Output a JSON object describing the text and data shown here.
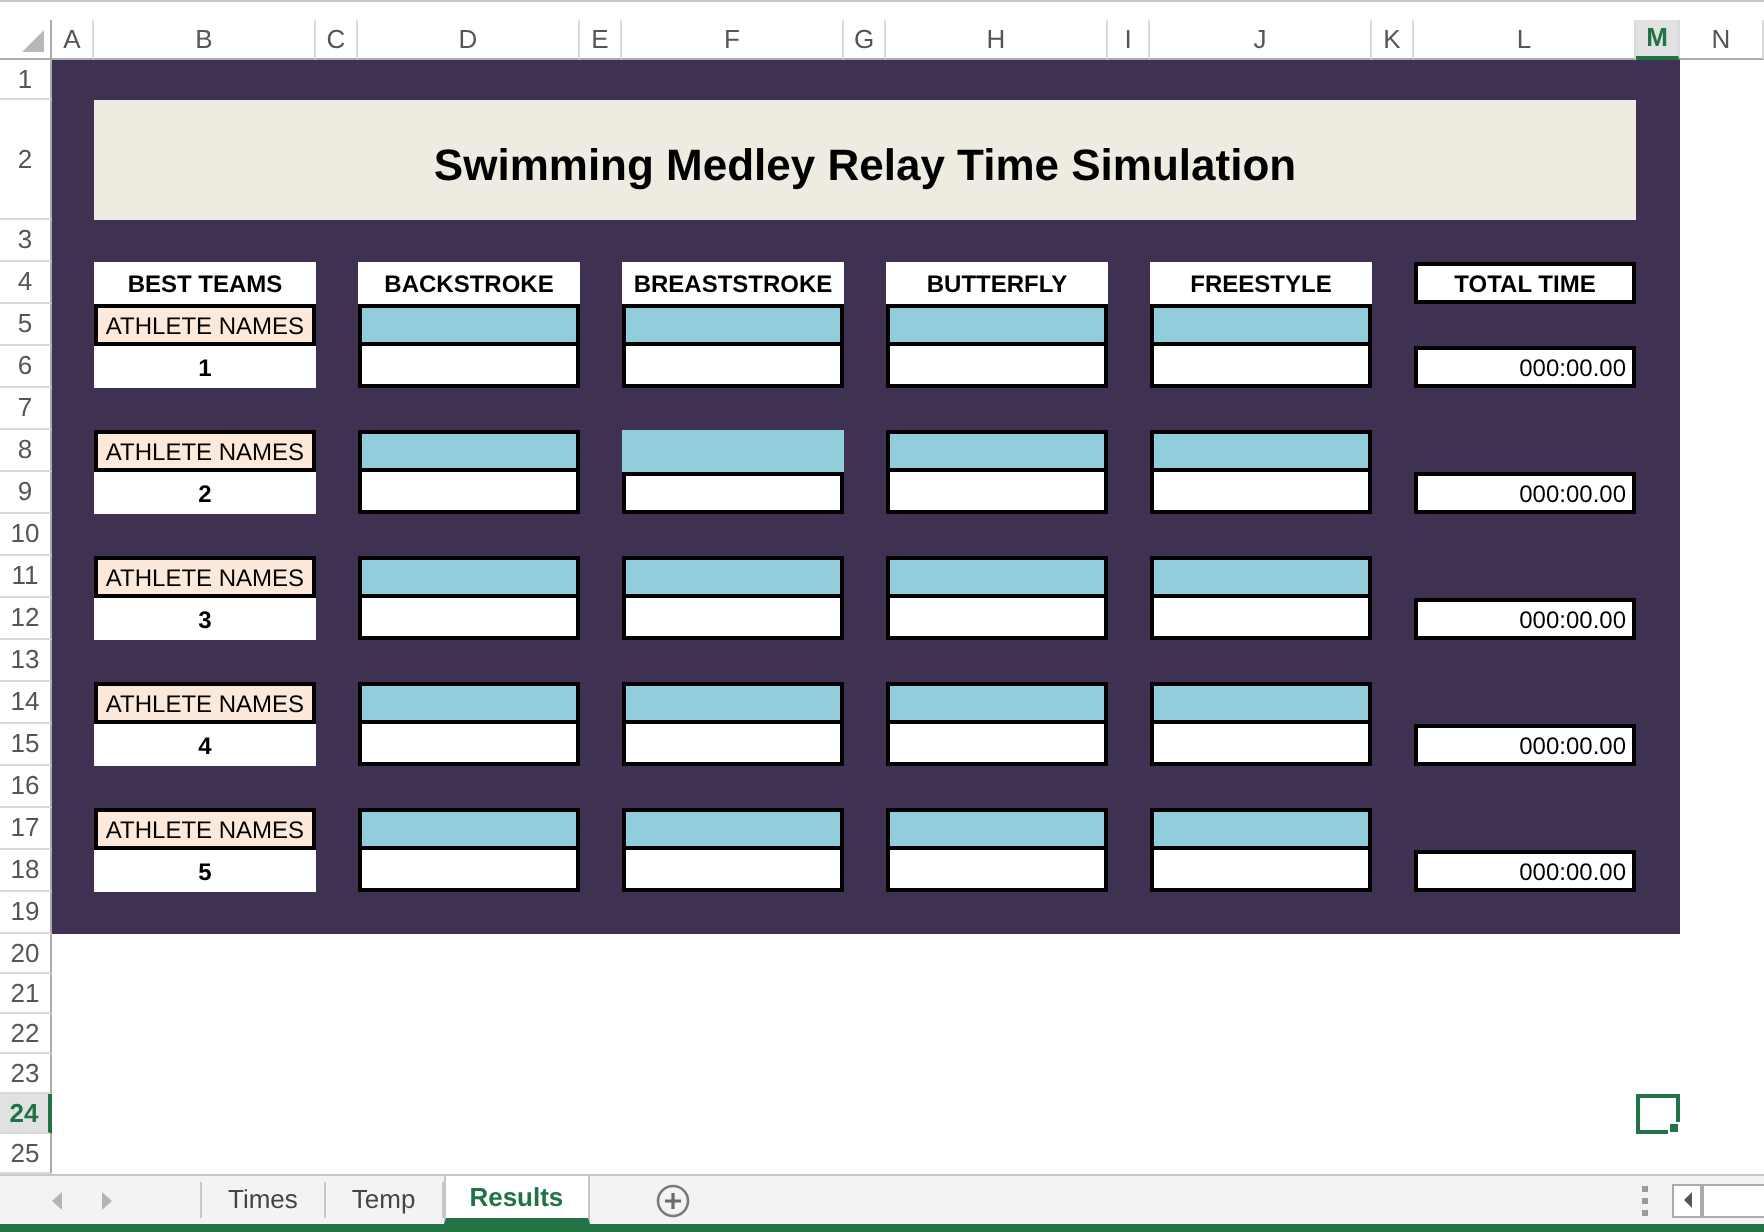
{
  "column_headers": [
    {
      "label": "A",
      "selected": false
    },
    {
      "label": "B",
      "selected": false
    },
    {
      "label": "C",
      "selected": false
    },
    {
      "label": "D",
      "selected": false
    },
    {
      "label": "E",
      "selected": false
    },
    {
      "label": "F",
      "selected": false
    },
    {
      "label": "G",
      "selected": false
    },
    {
      "label": "H",
      "selected": false
    },
    {
      "label": "I",
      "selected": false
    },
    {
      "label": "J",
      "selected": false
    },
    {
      "label": "K",
      "selected": false
    },
    {
      "label": "L",
      "selected": false
    },
    {
      "label": "M",
      "selected": true
    },
    {
      "label": "N",
      "selected": false
    }
  ],
  "row_headers": [
    {
      "label": "1",
      "selected": false
    },
    {
      "label": "2",
      "selected": false
    },
    {
      "label": "3",
      "selected": false
    },
    {
      "label": "4",
      "selected": false
    },
    {
      "label": "5",
      "selected": false
    },
    {
      "label": "6",
      "selected": false
    },
    {
      "label": "7",
      "selected": false
    },
    {
      "label": "8",
      "selected": false
    },
    {
      "label": "9",
      "selected": false
    },
    {
      "label": "10",
      "selected": false
    },
    {
      "label": "11",
      "selected": false
    },
    {
      "label": "12",
      "selected": false
    },
    {
      "label": "13",
      "selected": false
    },
    {
      "label": "14",
      "selected": false
    },
    {
      "label": "15",
      "selected": false
    },
    {
      "label": "16",
      "selected": false
    },
    {
      "label": "17",
      "selected": false
    },
    {
      "label": "18",
      "selected": false
    },
    {
      "label": "19",
      "selected": false
    },
    {
      "label": "20",
      "selected": false
    },
    {
      "label": "21",
      "selected": false
    },
    {
      "label": "22",
      "selected": false
    },
    {
      "label": "23",
      "selected": false
    },
    {
      "label": "24",
      "selected": true
    },
    {
      "label": "25",
      "selected": false
    }
  ],
  "sheet": {
    "title": "Swimming Medley Relay Time Simulation",
    "teams_heading": "BEST TEAMS",
    "stroke_headings": [
      "BACKSTROKE",
      "BREASTSTROKE",
      "BUTTERFLY",
      "FREESTYLE"
    ],
    "total_heading": "TOTAL TIME",
    "teams": [
      {
        "athlete_label": "ATHLETE NAMES",
        "number": "1",
        "athlete_cells": [
          {
            "outlined": true
          },
          {
            "outlined": true
          },
          {
            "outlined": true
          },
          {
            "outlined": true
          }
        ],
        "total_time": "000:00.00"
      },
      {
        "athlete_label": "ATHLETE NAMES",
        "number": "2",
        "athlete_cells": [
          {
            "outlined": true
          },
          {
            "outlined": false
          },
          {
            "outlined": true
          },
          {
            "outlined": true
          }
        ],
        "total_time": "000:00.00"
      },
      {
        "athlete_label": "ATHLETE NAMES",
        "number": "3",
        "athlete_cells": [
          {
            "outlined": true
          },
          {
            "outlined": true
          },
          {
            "outlined": true
          },
          {
            "outlined": true
          }
        ],
        "total_time": "000:00.00"
      },
      {
        "athlete_label": "ATHLETE NAMES",
        "number": "4",
        "athlete_cells": [
          {
            "outlined": true
          },
          {
            "outlined": true
          },
          {
            "outlined": true
          },
          {
            "outlined": true
          }
        ],
        "total_time": "000:00.00"
      },
      {
        "athlete_label": "ATHLETE NAMES",
        "number": "5",
        "athlete_cells": [
          {
            "outlined": true
          },
          {
            "outlined": true
          },
          {
            "outlined": true
          },
          {
            "outlined": true
          }
        ],
        "total_time": "000:00.00"
      }
    ]
  },
  "sheet_tabs": [
    {
      "label": "Times",
      "selected": false
    },
    {
      "label": "Temp",
      "selected": false
    },
    {
      "label": "Results",
      "selected": true
    }
  ]
}
